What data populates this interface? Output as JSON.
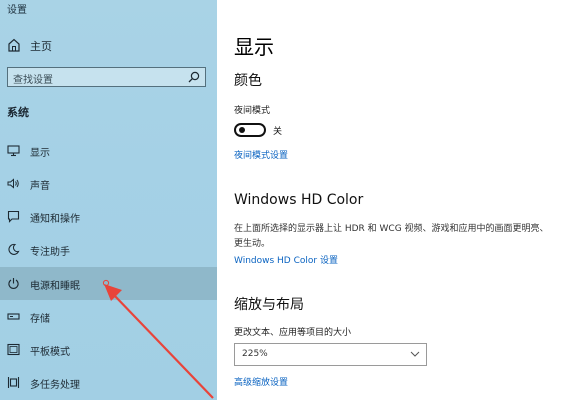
{
  "app": {
    "title": "设置"
  },
  "sidebar": {
    "home_label": "主页",
    "search_placeholder": "查找设置",
    "section_label": "系统",
    "items": [
      {
        "label": "显示",
        "icon": "monitor-icon"
      },
      {
        "label": "声音",
        "icon": "speaker-icon"
      },
      {
        "label": "通知和操作",
        "icon": "notification-icon"
      },
      {
        "label": "专注助手",
        "icon": "moon-icon"
      },
      {
        "label": "电源和睡眠",
        "icon": "power-icon",
        "selected": true
      },
      {
        "label": "存储",
        "icon": "storage-icon"
      },
      {
        "label": "平板模式",
        "icon": "tablet-icon"
      },
      {
        "label": "多任务处理",
        "icon": "multitask-icon"
      }
    ]
  },
  "main": {
    "title": "显示",
    "color": {
      "heading": "颜色",
      "night_light_label": "夜间模式",
      "toggle_state": "关",
      "night_light_link": "夜间模式设置"
    },
    "hdr": {
      "heading": "Windows HD Color",
      "description": "在上面所选择的显示器上让 HDR 和 WCG 视频、游戏和应用中的画面更明亮、更生动。",
      "link": "Windows HD Color 设置"
    },
    "scale": {
      "heading": "缩放与布局",
      "label": "更改文本、应用等项目的大小",
      "value": "225%",
      "advanced_link": "高级缩放设置"
    }
  },
  "colors": {
    "sidebar_bg": "#a5d1e6",
    "selected_bg": "#8cb4c6",
    "link": "#0a63c1",
    "annotation_arrow": "#e8443a"
  }
}
